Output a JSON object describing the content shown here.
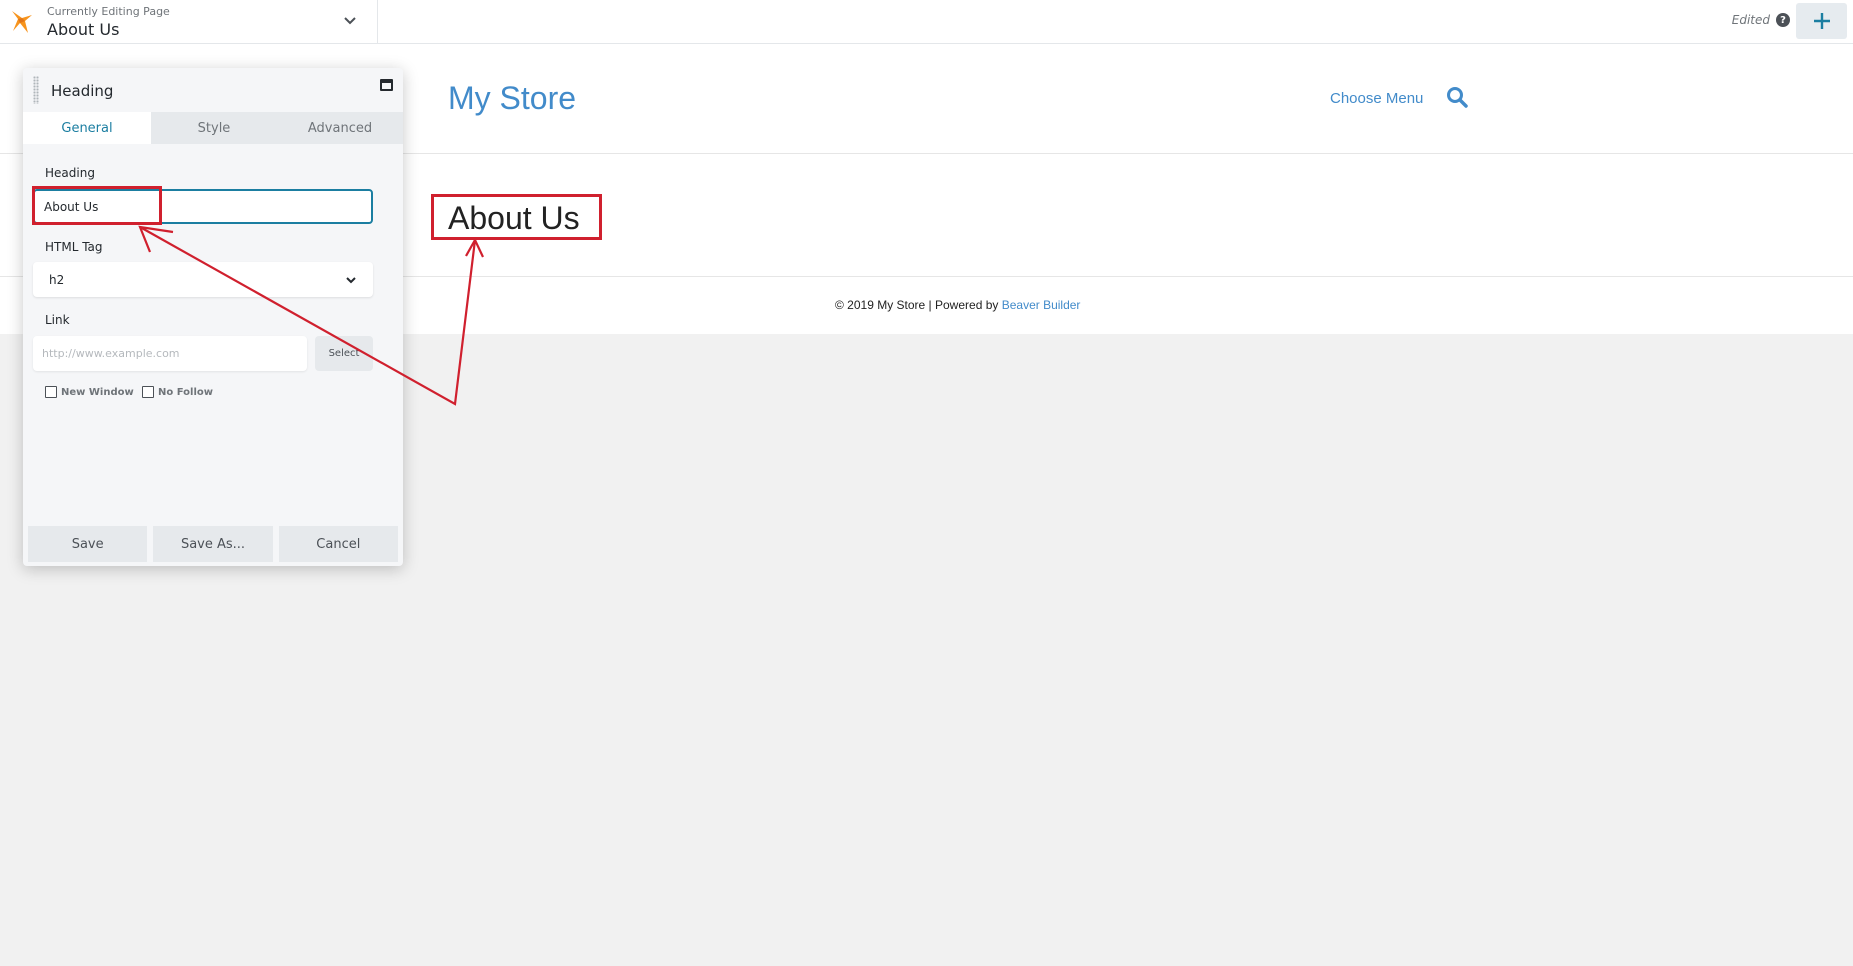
{
  "topbar": {
    "editing_label": "Currently Editing Page",
    "page_title": "About Us",
    "status": "Edited",
    "help_glyph": "?",
    "brand_color": "#f7941d"
  },
  "site": {
    "title": "My Store",
    "menu_label": "Choose Menu",
    "heading": "About Us",
    "footer_prefix": "© 2019 My Store | Powered by ",
    "footer_link": "Beaver Builder",
    "accent_color": "#428bca"
  },
  "panel": {
    "title": "Heading",
    "tabs": [
      {
        "label": "General",
        "active": true
      },
      {
        "label": "Style",
        "active": false
      },
      {
        "label": "Advanced",
        "active": false
      }
    ],
    "heading_label": "Heading",
    "heading_value": "About Us",
    "tag_label": "HTML Tag",
    "tag_value": "h2",
    "link_label": "Link",
    "link_placeholder": "http://www.example.com",
    "link_select_label": "Select",
    "new_window_label": "New Window",
    "no_follow_label": "No Follow",
    "save_label": "Save",
    "save_as_label": "Save As...",
    "cancel_label": "Cancel"
  },
  "annotation_color": "#d0202e"
}
